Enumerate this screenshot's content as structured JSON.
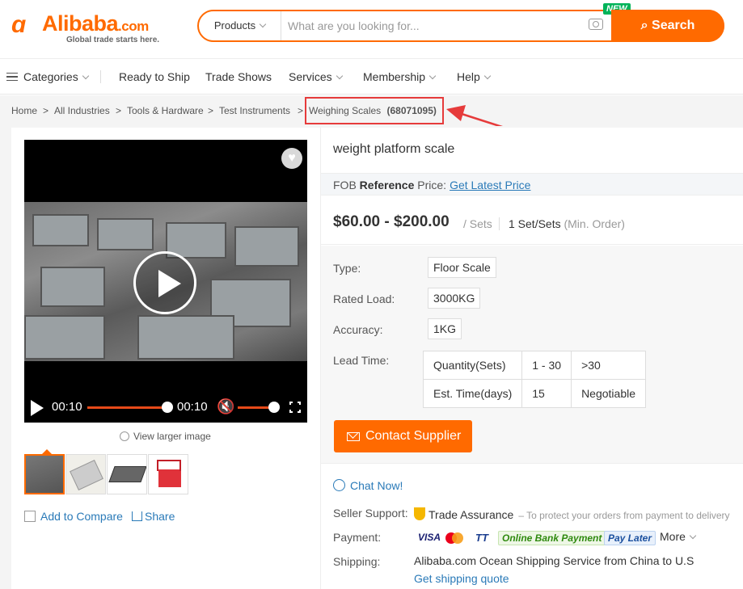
{
  "header": {
    "logo_text": "Alibaba",
    "logo_suffix": ".com",
    "tagline": "Global trade starts here.",
    "search_category": "Products",
    "search_placeholder": "What are you looking for...",
    "new_badge": "NEW",
    "search_button": "Search"
  },
  "nav": {
    "items": [
      "Categories",
      "Ready to Ship",
      "Trade Shows",
      "Services",
      "Membership",
      "Help"
    ]
  },
  "breadcrumb": {
    "items": [
      "Home",
      "All Industries",
      "Tools & Hardware",
      "Test Instruments"
    ],
    "current": "Weighing Scales",
    "current_count": "(68071095)"
  },
  "media": {
    "time_elapsed": "00:10",
    "time_total": "00:10",
    "progress_fraction": 1.0,
    "volume_fraction": 1.0,
    "view_larger": "View larger image"
  },
  "actions": {
    "add_to_compare": "Add to Compare",
    "share": "Share"
  },
  "product": {
    "title": "weight platform scale",
    "fob_prefix": "FOB",
    "fob_bold": "Reference",
    "fob_suffix": "Price:",
    "get_latest_price": "Get Latest Price",
    "price_range": "$60.00 - $200.00",
    "price_unit": "/ Sets",
    "min_order": "1 Set/Sets",
    "min_order_note": "(Min. Order)"
  },
  "attributes": [
    {
      "label": "Type:",
      "value": "Floor Scale"
    },
    {
      "label": "Rated Load:",
      "value": "3000KG"
    },
    {
      "label": "Accuracy:",
      "value": "1KG"
    }
  ],
  "lead_time": {
    "label": "Lead Time:",
    "rows": [
      [
        "Quantity(Sets)",
        "1 - 30",
        ">30"
      ],
      [
        "Est. Time(days)",
        "15",
        "Negotiable"
      ]
    ]
  },
  "contact_button": "Contact Supplier",
  "chat_now": "Chat Now!",
  "seller_support": {
    "label": "Seller Support:",
    "trade_assurance": "Trade Assurance",
    "note": "– To protect your orders from payment to delivery"
  },
  "payment": {
    "label": "Payment:",
    "methods": [
      "VISA",
      "TT",
      "Online Bank Payment",
      "Pay Later"
    ],
    "more": "More"
  },
  "shipping": {
    "label": "Shipping:",
    "text": "Alibaba.com Ocean Shipping Service from China to U.S",
    "link": "Get shipping quote"
  },
  "colors": {
    "brand": "#ff6a00",
    "link": "#2a7ab8",
    "highlight": "#e63b3b"
  }
}
